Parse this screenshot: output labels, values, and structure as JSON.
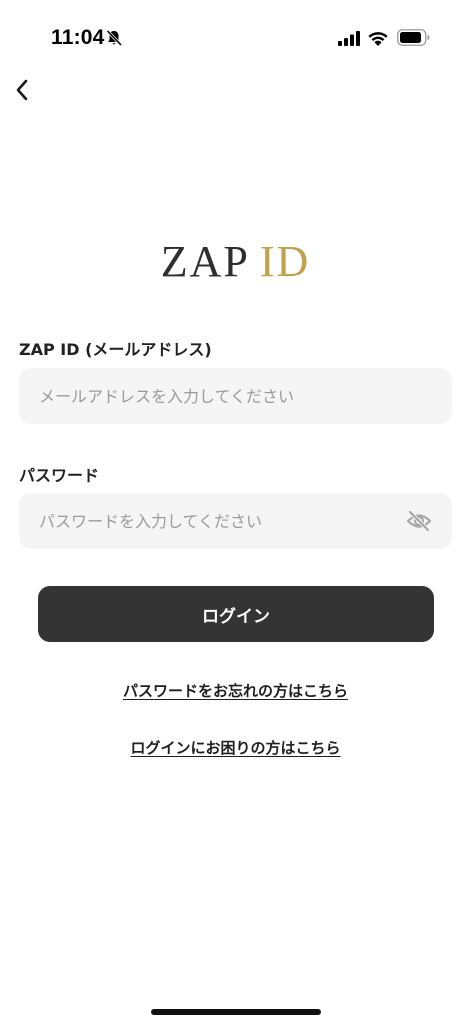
{
  "status_bar": {
    "time": "11:04",
    "icons": [
      "bell-muted-icon",
      "signal-icon",
      "wifi-icon",
      "battery-icon"
    ]
  },
  "nav": {
    "back_icon": "chevron-left-icon"
  },
  "logo": {
    "part1": "ZAP",
    "part2": "ID",
    "colors": {
      "part1": "#2e2e2e",
      "part2": "#c3a04c"
    }
  },
  "form": {
    "email_label": "ZAP ID (メールアドレス)",
    "email_value": "",
    "email_placeholder": "メールアドレスを入力してください",
    "password_label": "パスワード",
    "password_value": "",
    "password_placeholder": "パスワードを入力してください",
    "password_visibility_icon": "eye-off-icon",
    "login_label": "ログイン"
  },
  "links": {
    "forgot_password": "パスワードをお忘れの方はこちら",
    "login_help": "ログインにお困りの方はこちら"
  },
  "colors": {
    "button_bg": "#343434",
    "input_bg": "#f5f5f5",
    "accent_gold": "#c3a04c"
  }
}
